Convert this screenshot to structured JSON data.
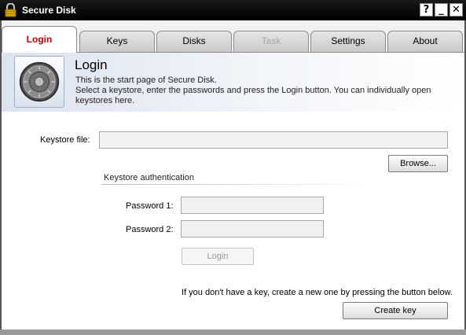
{
  "window": {
    "title": "Secure Disk",
    "buttons": {
      "help": "?",
      "minimize": "_",
      "close": "✕"
    }
  },
  "tabs": [
    {
      "label": "Login",
      "state": "active"
    },
    {
      "label": "Keys",
      "state": "normal"
    },
    {
      "label": "Disks",
      "state": "normal"
    },
    {
      "label": "Task",
      "state": "disabled"
    },
    {
      "label": "Settings",
      "state": "normal"
    },
    {
      "label": "About",
      "state": "normal"
    }
  ],
  "header": {
    "title": "Login",
    "description": "This is the start page of Secure Disk.\nSelect a keystore, enter the passwords and press the Login button. You can individually open keystores here."
  },
  "form": {
    "keystore_label": "Keystore file:",
    "keystore_value": "",
    "browse_label": "Browse...",
    "auth_group_title": "Keystore authentication",
    "password1_label": "Password 1:",
    "password1_value": "",
    "password2_label": "Password 2:",
    "password2_value": "",
    "login_label": "Login",
    "hint": "If you don't have a key, create a new one by pressing the button below.",
    "create_key_label": "Create key"
  },
  "colors": {
    "active_tab_text": "#cc0000",
    "titlebar": "#000000"
  },
  "icons": {
    "app": "lock-icon",
    "header_logo": "safe-dial-icon"
  }
}
